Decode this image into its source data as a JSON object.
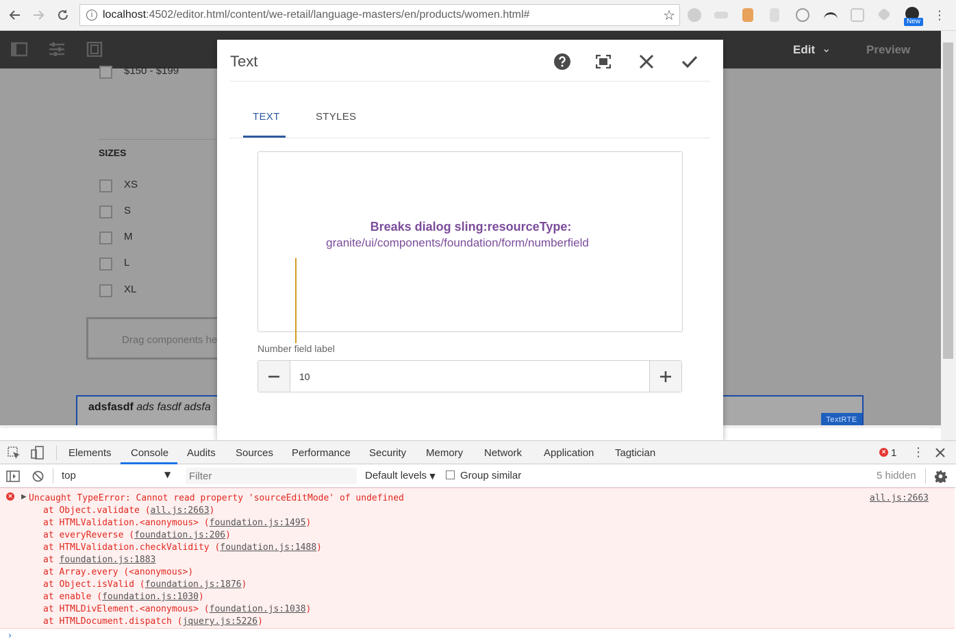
{
  "browser": {
    "url_host": "localhost",
    "url_rest": ":4502/editor.html/content/we-retail/language-masters/en/products/women.html#",
    "new_badge": "New"
  },
  "aem": {
    "mode_label": "Edit",
    "preview_label": "Preview",
    "price_option": "$150 - $199",
    "sizes_heading": "SIZES",
    "sizes": [
      "XS",
      "S",
      "M",
      "L",
      "XL"
    ],
    "drag_placeholder": "Drag components he",
    "rte_bold": "adsfasdf",
    "rte_italic": " ads fasdf adsfa",
    "rte_badge": "TextRTE"
  },
  "dialog": {
    "title": "Text",
    "tabs": [
      "TEXT",
      "STYLES"
    ],
    "annotation_line1": "Breaks dialog sling:resourceType:",
    "annotation_line2": "granite/ui/components/foundation/form/numberfield",
    "numberfield_label": "Number field label",
    "numberfield_value": "10"
  },
  "devtools": {
    "tabs": [
      "Elements",
      "Console",
      "Audits",
      "Sources",
      "Performance",
      "Security",
      "Memory",
      "Network",
      "Application",
      "Tagtician"
    ],
    "error_count": "1",
    "context": "top",
    "filter_placeholder": "Filter",
    "levels": "Default levels",
    "group_similar": "Group similar",
    "hidden": "5 hidden",
    "error_message": "Uncaught TypeError: Cannot read property 'sourceEditMode' of undefined",
    "error_source": "all.js:2663",
    "stack": [
      {
        "pre": "at Object.validate (",
        "link": "all.js:2663",
        "post": ")"
      },
      {
        "pre": "at HTMLValidation.<anonymous> (",
        "link": "foundation.js:1495",
        "post": ")"
      },
      {
        "pre": "at everyReverse (",
        "link": "foundation.js:206",
        "post": ")"
      },
      {
        "pre": "at HTMLValidation.checkValidity (",
        "link": "foundation.js:1488",
        "post": ")"
      },
      {
        "pre": "at ",
        "link": "foundation.js:1883",
        "post": ""
      },
      {
        "pre": "at Array.every (<anonymous>)",
        "link": "",
        "post": ""
      },
      {
        "pre": "at Object.isValid (",
        "link": "foundation.js:1876",
        "post": ")"
      },
      {
        "pre": "at enable (",
        "link": "foundation.js:1030",
        "post": ")"
      },
      {
        "pre": "at HTMLDivElement.<anonymous> (",
        "link": "foundation.js:1038",
        "post": ")"
      },
      {
        "pre": "at HTMLDocument.dispatch (",
        "link": "jquery.js:5226",
        "post": ")"
      }
    ]
  },
  "colors": {
    "accent": "#2c5aa0",
    "annotation": "#7b4c9a",
    "error": "#e0281e"
  },
  "icons": [
    "back-icon",
    "forward-icon",
    "reload-icon",
    "info-icon",
    "star-icon",
    "menu-icon",
    "help-icon",
    "fullscreen-icon",
    "close-icon",
    "check-icon",
    "minus-icon",
    "plus-icon",
    "gear-icon"
  ]
}
